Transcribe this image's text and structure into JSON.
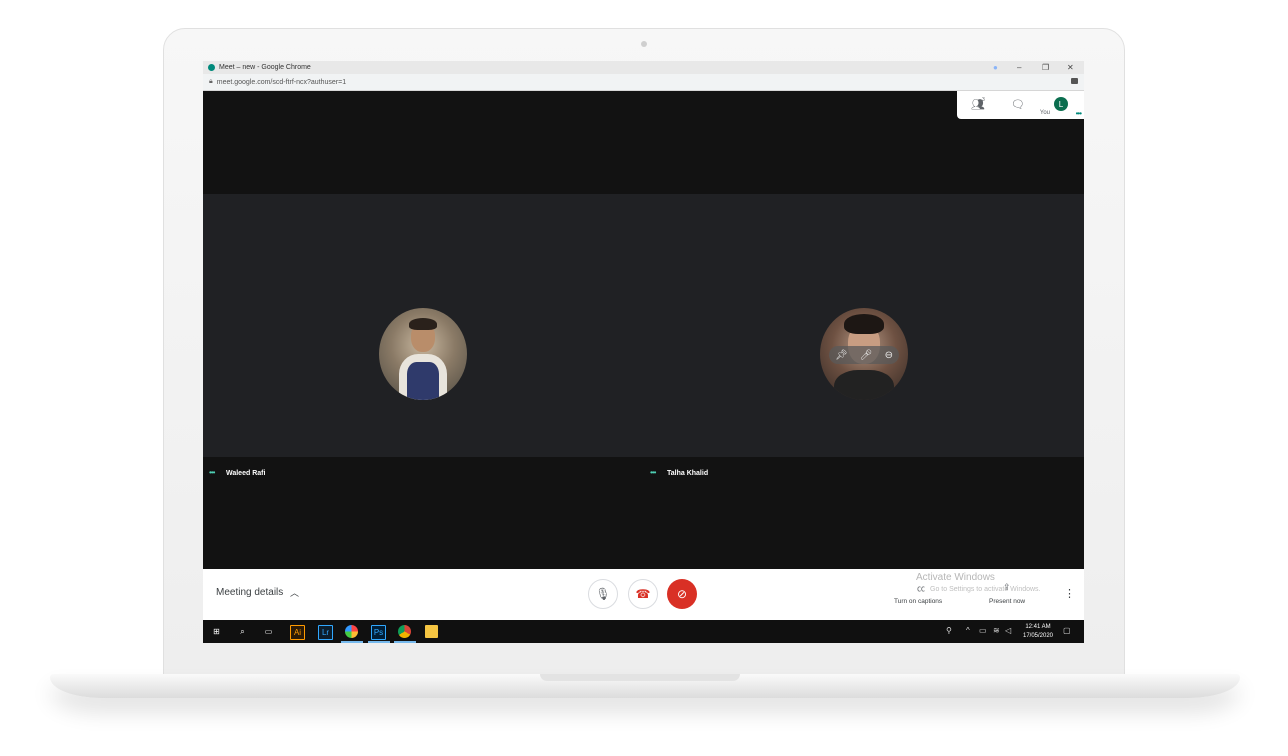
{
  "browser": {
    "title": "Meet – new - Google Chrome",
    "url": "meet.google.com/scd-ftrf-ncx?authuser=1",
    "minimize": "–",
    "maximize": "❐",
    "close": "✕"
  },
  "top_panel": {
    "people_count": "3",
    "you_label": "You",
    "avatar_initial": "L"
  },
  "participants": [
    {
      "name": "Waleed Rafi"
    },
    {
      "name": "Talha Khalid"
    }
  ],
  "bottom_bar": {
    "meeting_details": "Meeting details",
    "activate_title": "Activate Windows",
    "activate_sub": "Go to Settings to activate Windows.",
    "captions_label": "Turn on captions",
    "present_label": "Present now"
  },
  "taskbar": {
    "time": "12:41 AM",
    "date": "17/05/2020",
    "apps": [
      "Ai",
      "Lr",
      "Ps"
    ]
  },
  "colors": {
    "hangup": "#d93025",
    "accent": "#00897b",
    "tile_bg": "#202124",
    "meet_bg": "#121212"
  }
}
